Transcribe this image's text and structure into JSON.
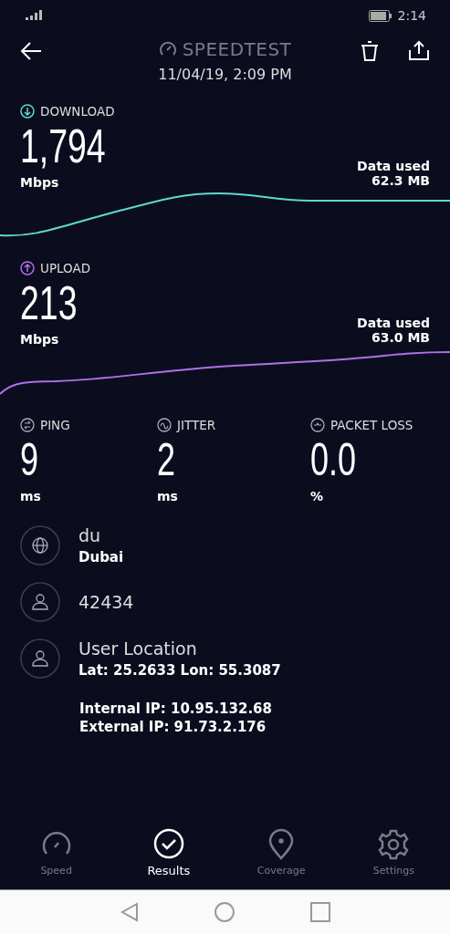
{
  "status_bar": {
    "time": "2:14"
  },
  "header": {
    "title": "SPEEDTEST",
    "date": "11/04/19, 2:09 PM"
  },
  "transfers": [
    {
      "kind": "download",
      "label": "DOWNLOAD",
      "value": "1,794",
      "unit": "Mbps",
      "data_label": "Data used",
      "data_value": "62.3 MB",
      "color": "#5fd8d0"
    },
    {
      "kind": "upload",
      "label": "UPLOAD",
      "value": "213",
      "unit": "Mbps",
      "data_label": "Data used",
      "data_value": "63.0 MB",
      "color": "#b070e8"
    }
  ],
  "stats": [
    {
      "kind": "ping",
      "label": "PING",
      "value": "9",
      "unit": "ms"
    },
    {
      "kind": "jitter",
      "label": "JITTER",
      "value": "2",
      "unit": "ms"
    },
    {
      "kind": "loss",
      "label": "PACKET LOSS",
      "value": "0.0",
      "unit": "%"
    }
  ],
  "info": [
    {
      "kind": "isp",
      "title": "du",
      "detail": "Dubai"
    },
    {
      "kind": "server",
      "title": "42434"
    },
    {
      "kind": "location",
      "title": "User Location",
      "detail": "Lat: 25.2633 Lon: 55.3087"
    }
  ],
  "ips": [
    "Internal IP: 10.95.132.68",
    "External IP: 91.73.2.176"
  ],
  "tabs": [
    {
      "kind": "speed",
      "label": "Speed",
      "selected": false
    },
    {
      "kind": "results",
      "label": "Results",
      "selected": true
    },
    {
      "kind": "coverage",
      "label": "Coverage",
      "selected": false
    },
    {
      "kind": "settings",
      "label": "Settings",
      "selected": false
    }
  ]
}
